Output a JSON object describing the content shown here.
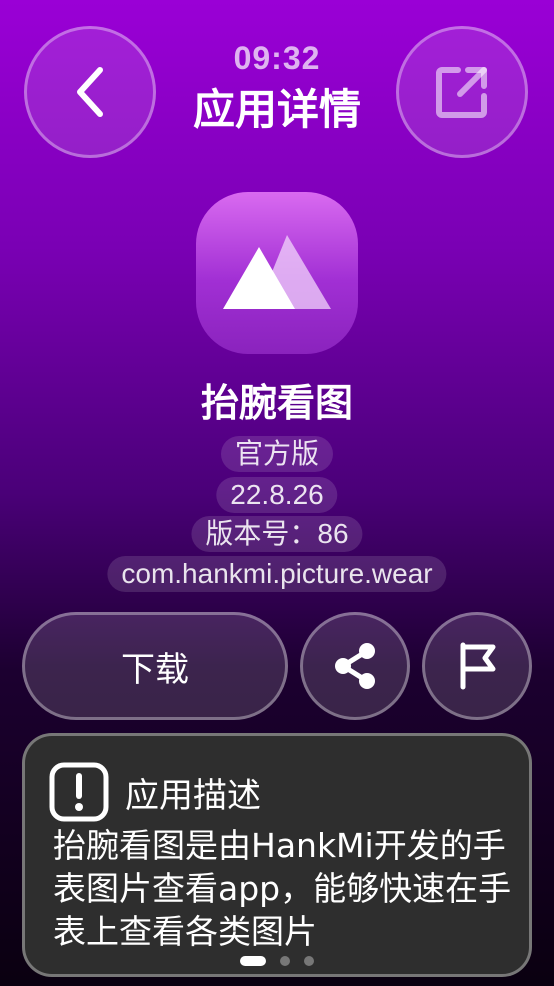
{
  "status": {
    "time": "09:32"
  },
  "header": {
    "title": "应用详情"
  },
  "app": {
    "name": "抬腕看图",
    "edition": "官方版",
    "version": "22.8.26",
    "version_code": "版本号：86",
    "package": "com.hankmi.picture.wear"
  },
  "actions": {
    "download_label": "下载"
  },
  "description": {
    "title": "应用描述",
    "text": "抬腕看图是由HankMi开发的手表图片查看app，能够快速在手表上查看各类图片"
  },
  "icons": {
    "back": "chevron-left-icon",
    "open": "open-external-icon",
    "share": "share-icon",
    "report": "flag-icon",
    "description": "exclamation-icon"
  },
  "pager": {
    "pages": 3,
    "current": 1
  }
}
